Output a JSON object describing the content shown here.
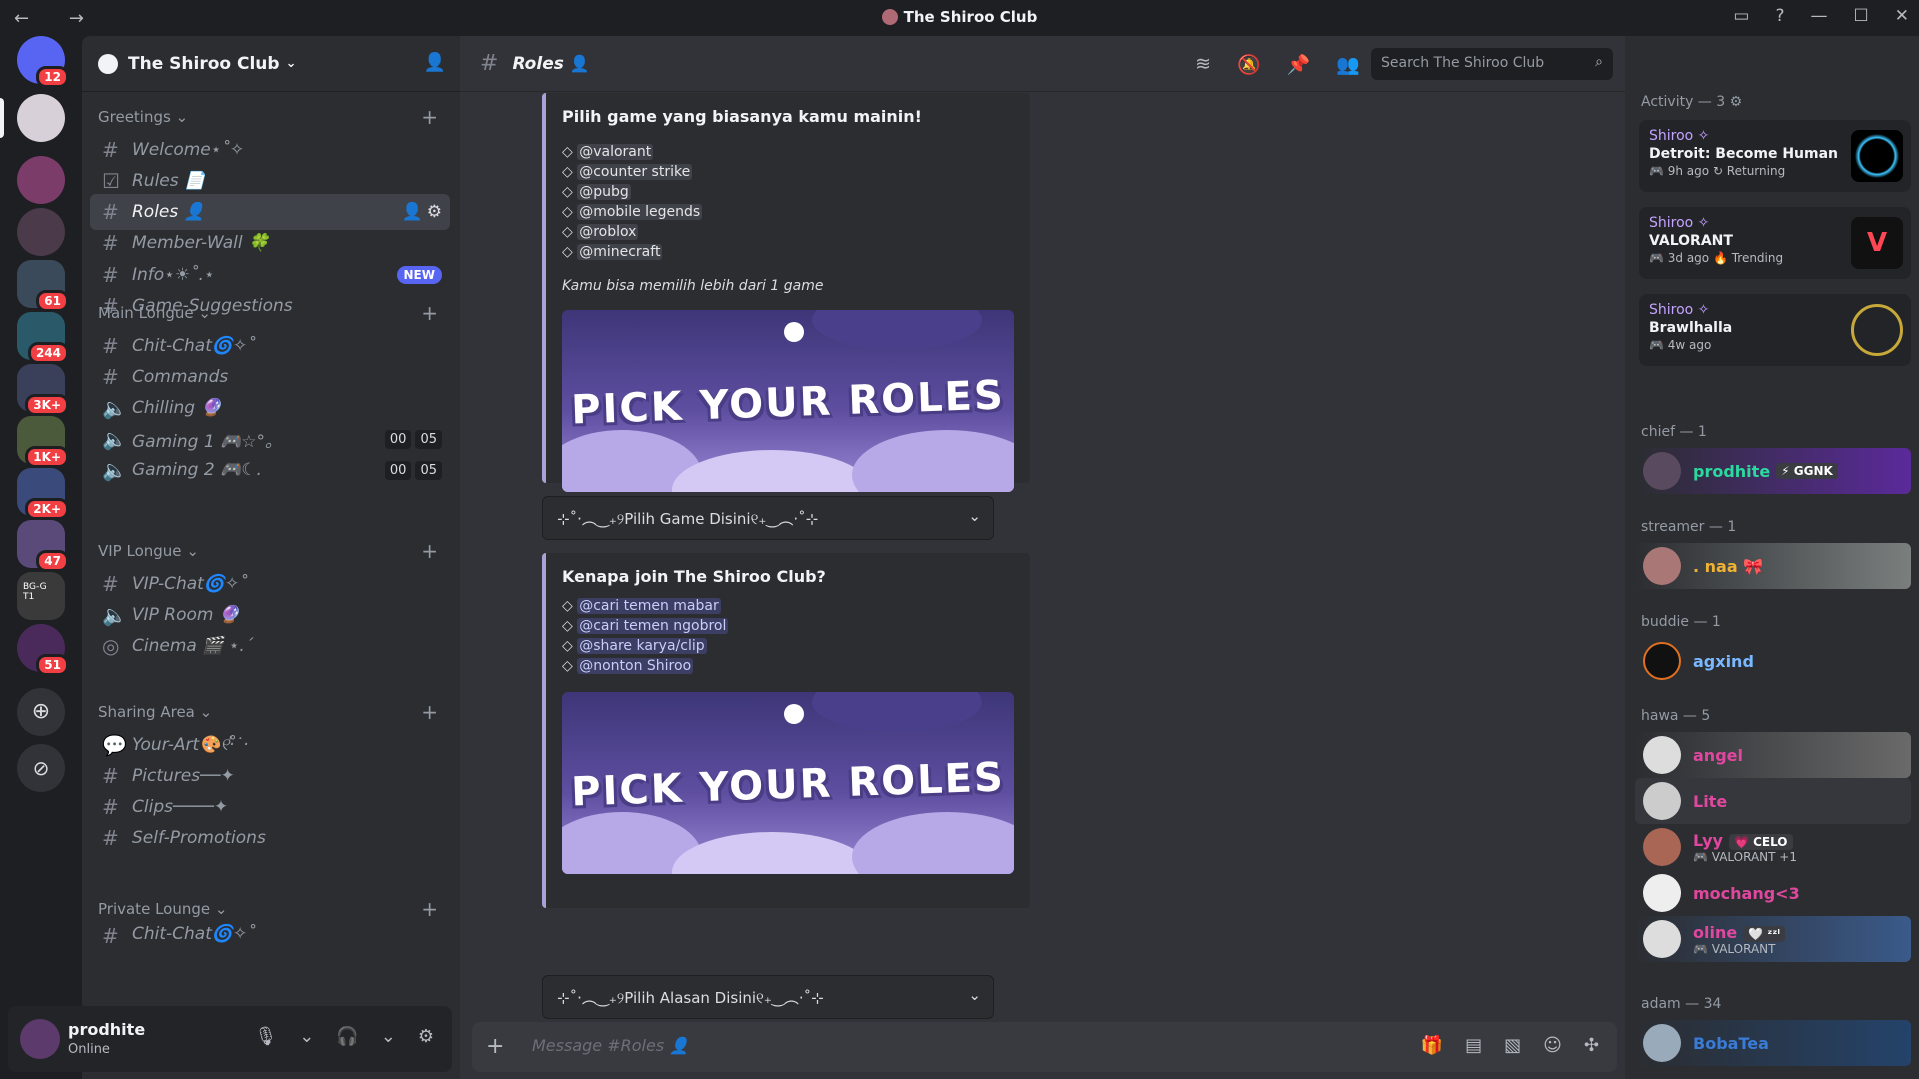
{
  "titlebar": {
    "title": "The Shiroo Club",
    "back": "←",
    "forward": "→",
    "inbox_icon": "inbox-icon",
    "help": "?",
    "min": "—",
    "max": "☐",
    "close": "✕"
  },
  "guilds": {
    "dm_badge": "12",
    "badges": [
      "61",
      "244",
      "3K+",
      "1K+",
      "2K+",
      "47",
      "51"
    ],
    "tiny_label": "BG-G",
    "tiny_label2": "T1"
  },
  "server": {
    "name": "The Shiroo Club"
  },
  "categories": {
    "greetings": "Greetings",
    "main": "Main Longue",
    "vip": "VIP Longue",
    "sharing": "Sharing Area",
    "private": "Private Lounge"
  },
  "channels": {
    "welcome": "Welcome⋆˚✧",
    "rules": "Rules 📄",
    "roles": "Roles 👤",
    "memberwall": "Member-Wall 🍀",
    "info": "Info⋆☀︎˚.⋆",
    "info_badge": "NEW",
    "suggest": "Game-Suggestions",
    "chit": "Chit-Chat🌀✧˚",
    "commands": "Commands",
    "chilling": "Chilling 🔮",
    "gaming1": "Gaming 1 🎮☆°｡",
    "gaming2": "Gaming 2 🎮☾.",
    "g_a": "00",
    "g_b": "05",
    "vipchat": "VIP-Chat🌀✧˚",
    "viproom": "VIP Room 🔮",
    "cinema": "Cinema 🎬 ⋆.ˊ",
    "yourart": "Your-Art🎨୧‧̍̊˙·",
    "pictures": "Pictures──✦",
    "clips": "Clips────✦",
    "selfpromo": "Self-Promotions",
    "partial": "Chit-Chat🌀✧˚"
  },
  "user": {
    "name": "prodhite",
    "status": "Online"
  },
  "header": {
    "channel": "Roles",
    "search_placeholder": "Search The Shiroo Club"
  },
  "embed1": {
    "title": "Pilih game yang biasanya kamu mainin!",
    "roles": [
      "@valorant",
      "@counter strike",
      "@pubg",
      "@mobile legends",
      "@roblox",
      "@minecraft"
    ],
    "note": "Kamu bisa memilih lebih dari 1 game",
    "banner": "PICK YOUR ROLES"
  },
  "select1": {
    "label": "⊹˚‧︵‿₊୨Pilih Game Disini୧₊‿︵‧˚⊹"
  },
  "embed2": {
    "title": "Kenapa join The Shiroo Club?",
    "roles": [
      "@cari temen mabar",
      "@cari temen ngobrol",
      "@share karya/clip",
      "@nonton Shiroo"
    ],
    "banner": "PICK YOUR ROLES"
  },
  "select2": {
    "label": "⊹˚‧︵‿₊୨Pilih Alasan Disini୧₊‿︵‧˚⊹"
  },
  "composer": {
    "placeholder": "Message #Roles 👤",
    "plus": "+"
  },
  "members": {
    "activity_header": "Activity — 3",
    "activities": [
      {
        "who": "Shiroo ✧",
        "game": "Detroit: Become Human",
        "meta": "🎮 9h ago  ↻ Returning"
      },
      {
        "who": "Shiroo ✧",
        "game": "VALORANT",
        "meta": "🎮 3d ago  🔥 Trending"
      },
      {
        "who": "Shiroo ✧",
        "game": "Brawlhalla",
        "meta": "🎮 4w ago"
      }
    ],
    "chief_header": "chief — 1",
    "chief": {
      "name": "prodhite",
      "tag": "⚡ GGNK"
    },
    "streamer_header": "streamer — 1",
    "streamer": {
      "name": ". naa 🎀"
    },
    "buddie_header": "buddie — 1",
    "buddie": {
      "name": "agxind"
    },
    "hawa_header": "hawa — 5",
    "hawa": [
      {
        "name": "angel"
      },
      {
        "name": "Lite"
      },
      {
        "name": "Lyy",
        "tag": "💗 CELO",
        "sub": "🎮 VALORANT +1"
      },
      {
        "name": "mochang<3"
      },
      {
        "name": "oline",
        "tag": "🤍 ᶻᶻˡ",
        "sub": "🎮 VALORANT"
      }
    ],
    "adam_header": "adam — 34",
    "adam": {
      "name": "BobaTea"
    }
  },
  "colors": {
    "accent": "#5865f2",
    "embed_border": "#a8a3d6"
  }
}
